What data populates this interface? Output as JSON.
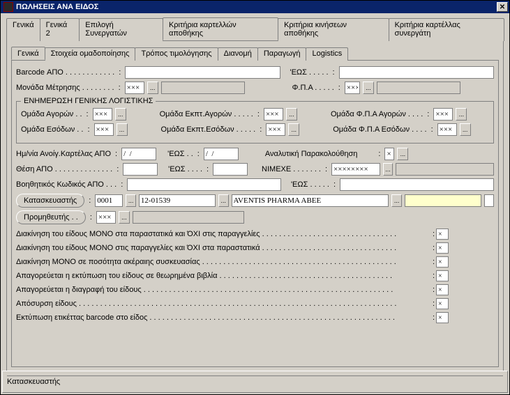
{
  "window": {
    "title": "ΠΩΛΗΣΕΙΣ ΑΝΑ ΕΙΔΟΣ"
  },
  "outer_tabs": {
    "t1": "Γενικά",
    "t2": "Γενικά 2",
    "t3": "Επιλογή Συνεργατών",
    "t4": "Κριτήρια καρτελλών αποθήκης",
    "t5": "Κριτήρια κινήσεων αποθήκης",
    "t6": "Κριτήρια καρτέλλας συνεργάτη"
  },
  "inner_tabs": {
    "i1": "Γενικά",
    "i2": "Στοιχεία ομαδοποίησης",
    "i3": "Τρόπος τιμολόγησης",
    "i4": "Διανομή",
    "i5": "Παραγωγή",
    "i6": "Logistics"
  },
  "labels": {
    "barcode_from": "Barcode ΑΠΟ . . . . . . . . . . . .",
    "barcode_to": "'ΕΩΣ . . . . .",
    "mm": "Μονάδα Μέτρησης . . . . . . . .",
    "fpa": "Φ.Π.Α . . . . .",
    "group_title": "ΕΝΗΜΕΡΩΣΗ ΓΕΝΙΚΗΣ ΛΟΓΙΣΤΙΚΗΣ",
    "om_agoron": "Ομάδα Αγορών . .",
    "om_esodon": "Ομάδα Εσόδων . .",
    "om_ekpt_agoron": "Ομάδα Εκπτ.Αγορών . . . . .",
    "om_ekpt_esodon": "Ομάδα Εκπτ.Εσόδων . . . . .",
    "om_fpa_agoron": "Ομάδα Φ.Π.Α Αγορών . . . .",
    "om_fpa_esodon": "Ομάδα Φ.Π.Α Εσόδων . . . .",
    "hm_open_from": "Ημ/νία Ανοίγ.Καρτέλας ΑΠΟ",
    "hm_open_to": "'ΕΩΣ . .",
    "anal_par": "Αναλυτική Παρακολούθηση",
    "thesi_from": "Θέση  ΑΠΟ . . . . . . . . . . . . . .",
    "thesi_to": "'ΕΩΣ . . . .",
    "nimexe": "ΝΙΜΕΧΕ . . . . . . .",
    "voith_from": "Βοηθητικός Κωδικός ΑΠΟ . . .",
    "voith_to": "'ΕΩΣ . . . . .",
    "manuf_btn": "Κατασκευαστής",
    "supplier_btn": "Προμηθευτής . .",
    "date_mask": "/  /",
    "xxx": "×××",
    "xxxxxxxx": "××××××××",
    "x": "×",
    "c1": "Διακίνηση του είδους ΜΟΝΟ στα παραστατικά και ΌΧΙ στις παραγγελίες . . . . . . . . . . . . . . . . . . . . . . . . . . . . . . . .",
    "c2": "Διακίνηση του είδους ΜΟΝΟ στις παραγγελίες και ΌΧΙ στα παραστατικά . . . . . . . . . . . . . . . . . . . . . . . . . . . . . . . .",
    "c3": "Διακίνηση ΜΟΝΟ σε ποσότητα ακέραιης συσκευασίας . . . . . . . . . . . . . . . . . . . . . . . . . . . . . . . . . . . . . . . . . . . . . .",
    "c4": "Απαγορεύεται η εκτύπωση του είδους σε θεωρημένα βιβλία . . . . . . . . . . . . . . . . . . . . . . . . . . . . . . . . . . . . . . . . .",
    "c5": "Απαγορεύεται η διαγραφή του είδους . . . . . . . . . . . . . . . . . . . . . . . . . . . . . . . . . . . . . . . . . . . . . . . . . . . . . . . . . . .",
    "c6": "Απόσυρση είδους . . . . . . . . . . . . . . . . . . . . . . . . . . . . . . . . . . . . . . . . . . . . . . . . . . . . . . . . . . . . . . . . . . . . . . . . . . .",
    "c7": "Εκτύπωση ετικέττας barcode στο είδος . . . . . . . . . . . . . . . . . . . . . . . . . . . . . . . . . . . . . . . . . . . . . . . . . . . . . . . . . ."
  },
  "values": {
    "manuf_code1": "0001",
    "manuf_code2": "12-01539",
    "manuf_name": "AVENTIS PHARMA ABEE"
  },
  "status": {
    "text": "Κατασκευαστής"
  },
  "icons": {
    "ellipsis": "...",
    "close": "✕"
  }
}
